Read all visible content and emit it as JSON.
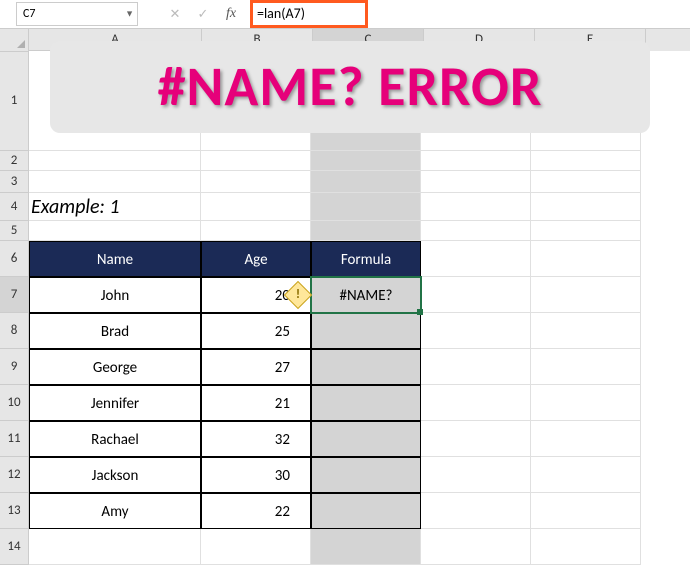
{
  "formula_bar": {
    "cell_ref": "C7",
    "cancel": "✕",
    "enter": "✓",
    "fx": "fx",
    "formula": "=lan(A7)"
  },
  "columns": {
    "A": "A",
    "B": "B",
    "C": "C",
    "D": "D",
    "E": "E"
  },
  "rows": {
    "r1": "1",
    "r2": "2",
    "r3": "3",
    "r4": "4",
    "r5": "5",
    "r6": "6",
    "r7": "7",
    "r8": "8",
    "r9": "9",
    "r10": "10",
    "r11": "11",
    "r12": "12",
    "r13": "13",
    "r14": "14"
  },
  "banner_text": "#NAME? ERROR",
  "example_label": "Example: 1",
  "table": {
    "headers": {
      "name": "Name",
      "age": "Age",
      "formula": "Formula"
    },
    "rows": [
      {
        "name": "John",
        "age": "20",
        "formula": "#NAME?"
      },
      {
        "name": "Brad",
        "age": "25",
        "formula": ""
      },
      {
        "name": "George",
        "age": "27",
        "formula": ""
      },
      {
        "name": "Jennifer",
        "age": "21",
        "formula": ""
      },
      {
        "name": "Rachael",
        "age": "32",
        "formula": ""
      },
      {
        "name": "Jackson",
        "age": "30",
        "formula": ""
      },
      {
        "name": "Amy",
        "age": "22",
        "formula": ""
      }
    ]
  },
  "error_icon_glyph": "!"
}
